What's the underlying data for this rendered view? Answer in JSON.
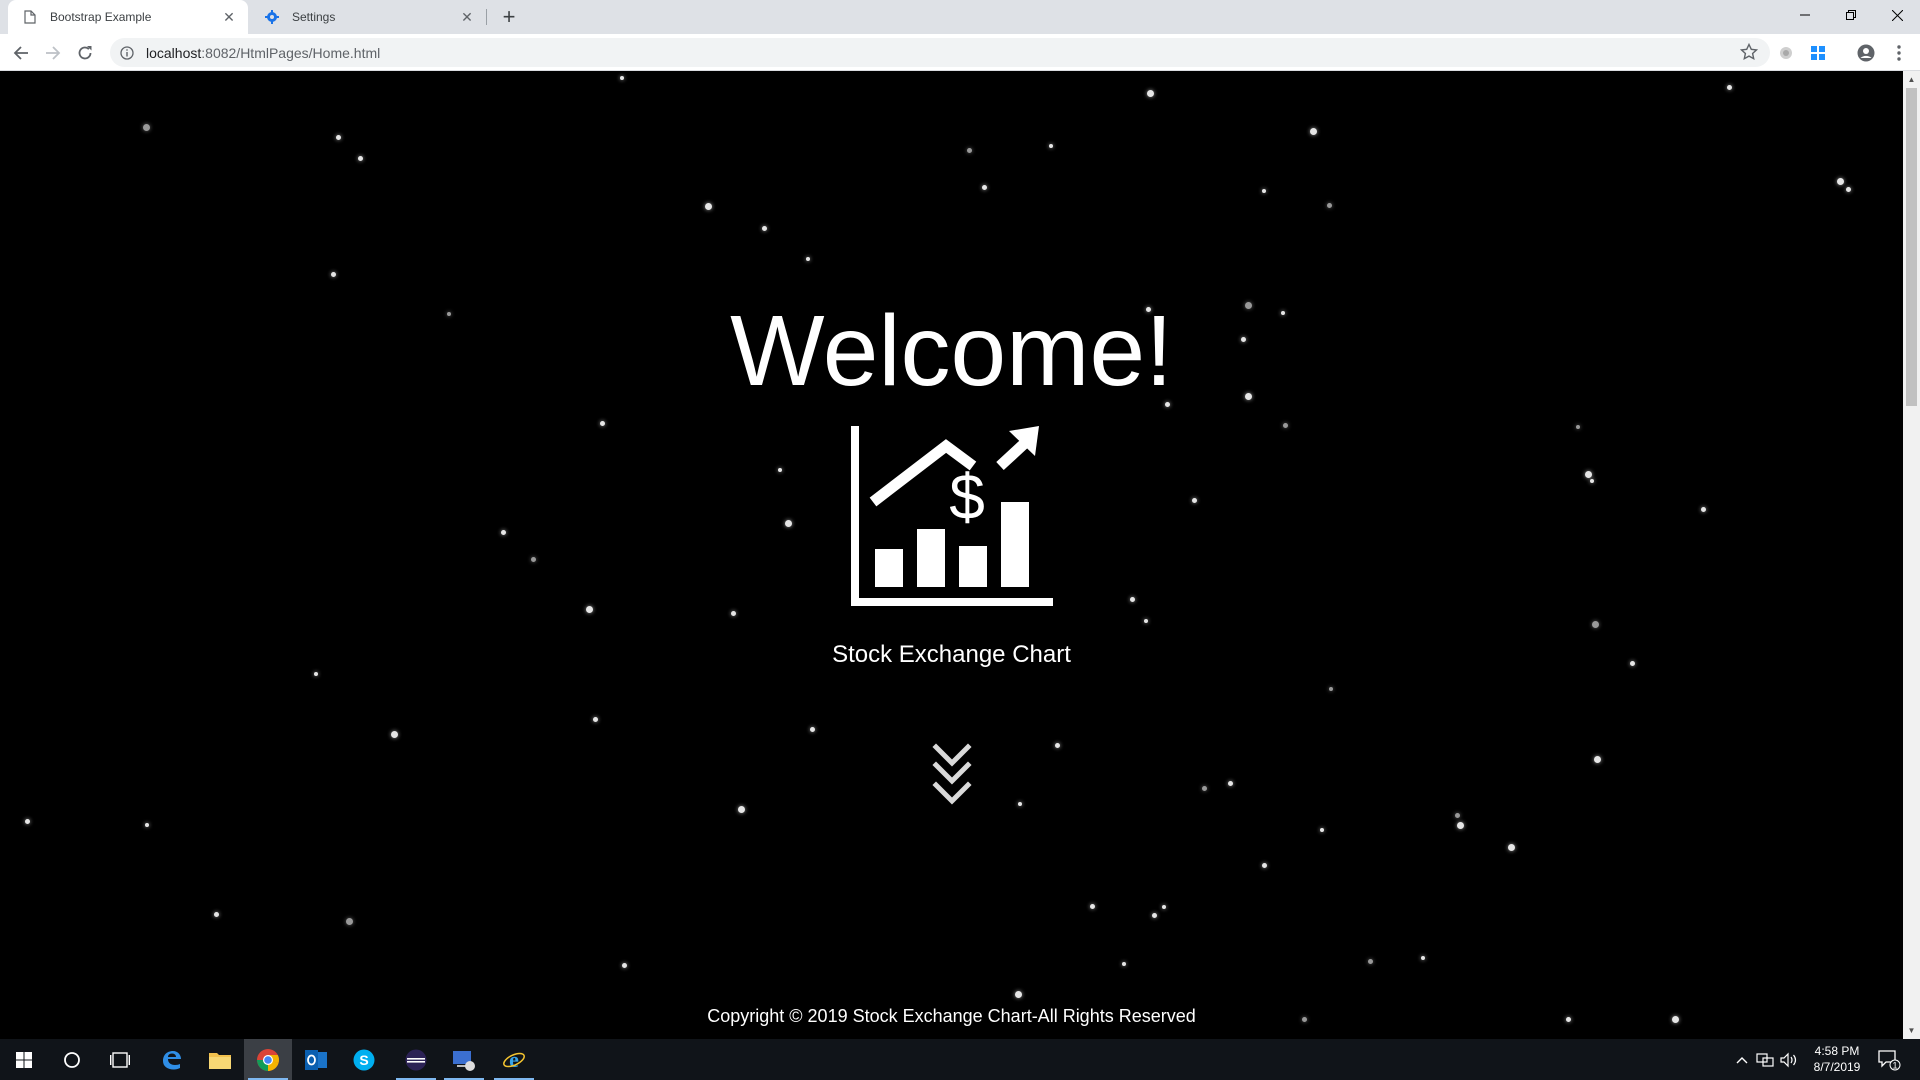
{
  "browser": {
    "tabs": [
      {
        "title": "Bootstrap Example",
        "active": true
      },
      {
        "title": "Settings",
        "active": false
      }
    ],
    "url_host": "localhost",
    "url_rest": ":8082/HtmlPages/Home.html"
  },
  "page": {
    "welcome": "Welcome!",
    "subtitle": "Stock Exchange Chart",
    "logo_symbol": "$",
    "footer": "Copyright © 2019 Stock Exchange Chart-All Rights Reserved"
  },
  "taskbar": {
    "apps": [
      "start-icon",
      "search-icon",
      "task-view-icon",
      "edge-icon",
      "file-explorer-icon",
      "chrome-icon",
      "outlook-icon",
      "skype-icon",
      "eclipse-icon",
      "remote-desktop-icon",
      "internet-explorer-icon"
    ],
    "time": "4:58 PM",
    "date": "8/7/2019",
    "notification_count": "1"
  }
}
